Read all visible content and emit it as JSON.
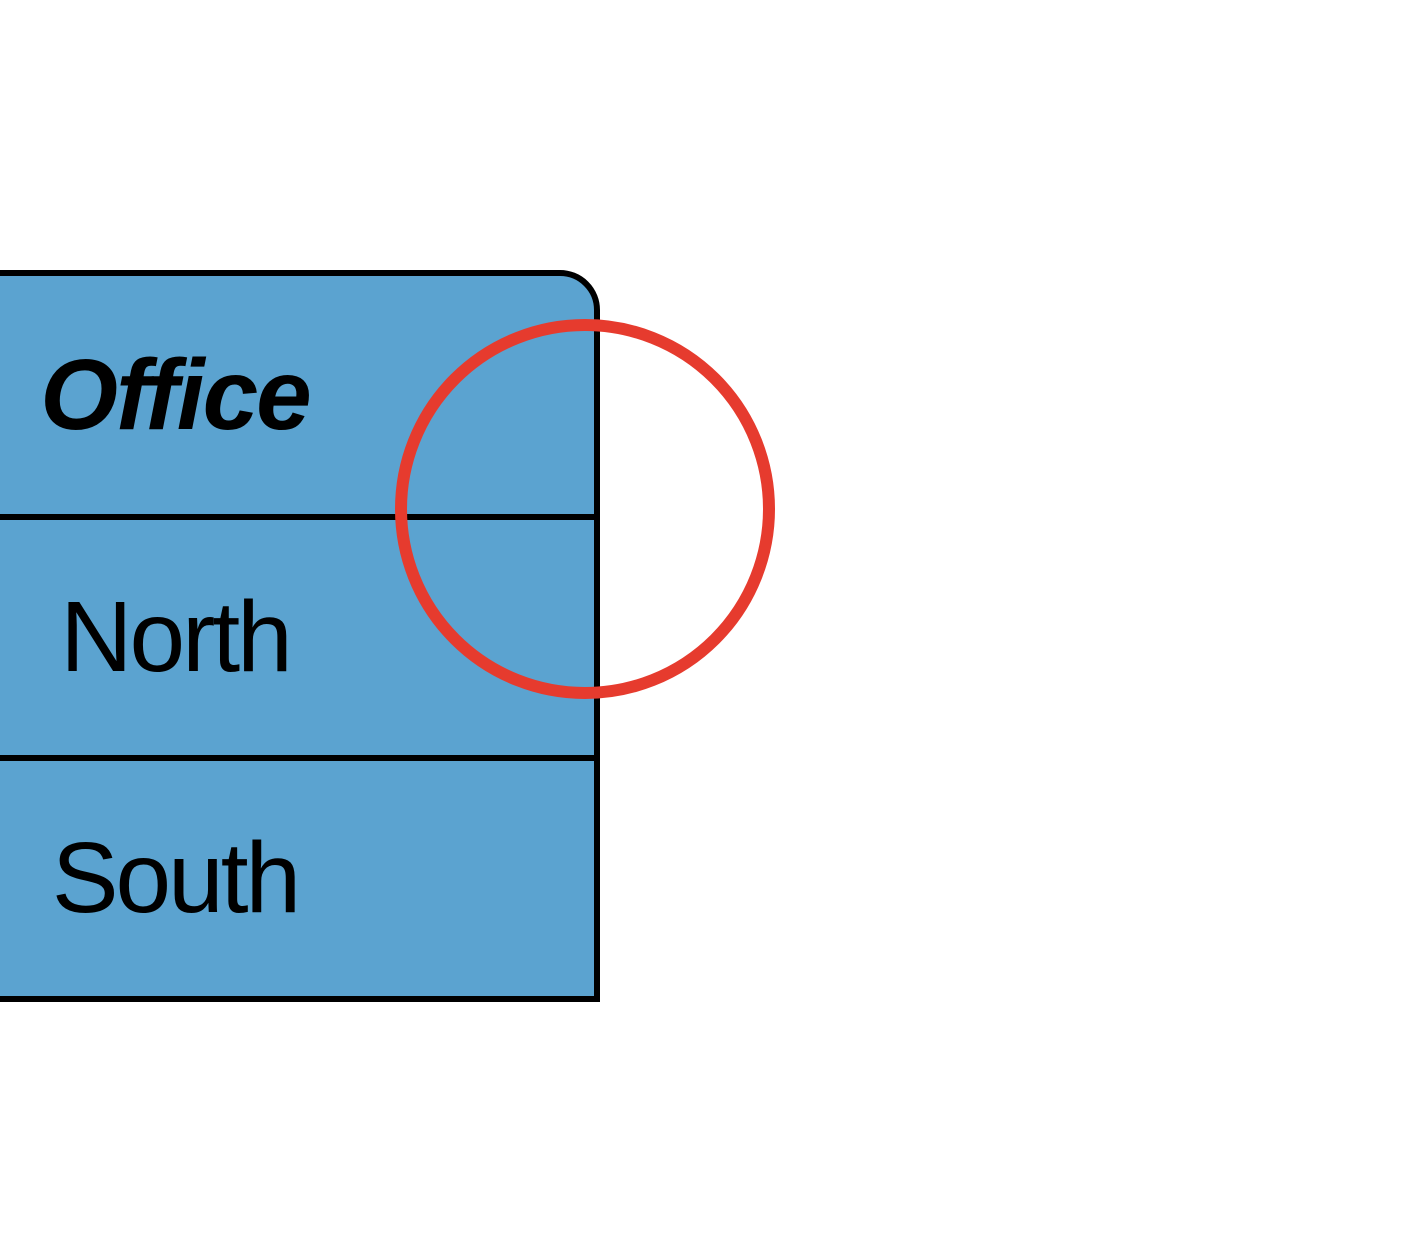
{
  "header": {
    "title": "Office"
  },
  "items": [
    {
      "label": "North"
    },
    {
      "label": "South"
    }
  ],
  "colors": {
    "box_fill": "#5ba3d0",
    "box_border": "#000000",
    "highlight_ring": "#e63b2e"
  }
}
